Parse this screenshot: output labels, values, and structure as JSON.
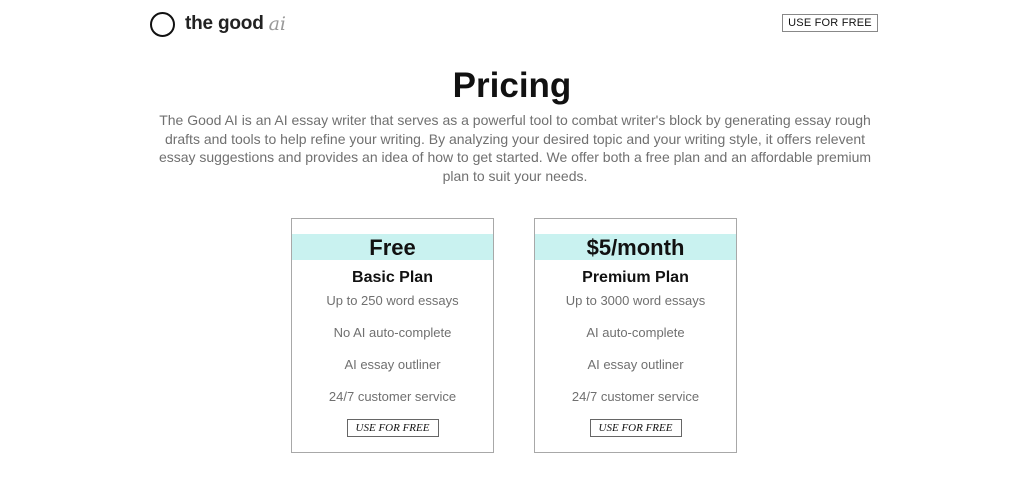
{
  "header": {
    "logo_text": "the good",
    "logo_ai": "ai",
    "cta_label": "USE FOR FREE"
  },
  "main": {
    "title": "Pricing",
    "intro": "The Good AI is an AI essay writer that serves as a powerful tool to combat writer's block by generating essay rough drafts and tools to help refine your writing. By analyzing your desired topic and your writing style, it offers relevent essay suggestions and provides an idea of how to get started. We offer both a free plan and an affordable premium plan to suit your needs."
  },
  "plans": [
    {
      "price": "Free",
      "name": "Basic Plan",
      "features": [
        "Up to 250 word essays",
        "No AI auto-complete",
        "AI essay outliner",
        "24/7 customer service"
      ],
      "button_label": "USE FOR FREE"
    },
    {
      "price": "$5/month",
      "name": "Premium Plan",
      "features": [
        "Up to 3000 word essays",
        "AI auto-complete",
        "AI essay outliner",
        "24/7 customer service"
      ],
      "button_label": "USE FOR FREE"
    }
  ],
  "colors": {
    "price_band": "#c9f2f0",
    "muted_text": "#707070"
  }
}
